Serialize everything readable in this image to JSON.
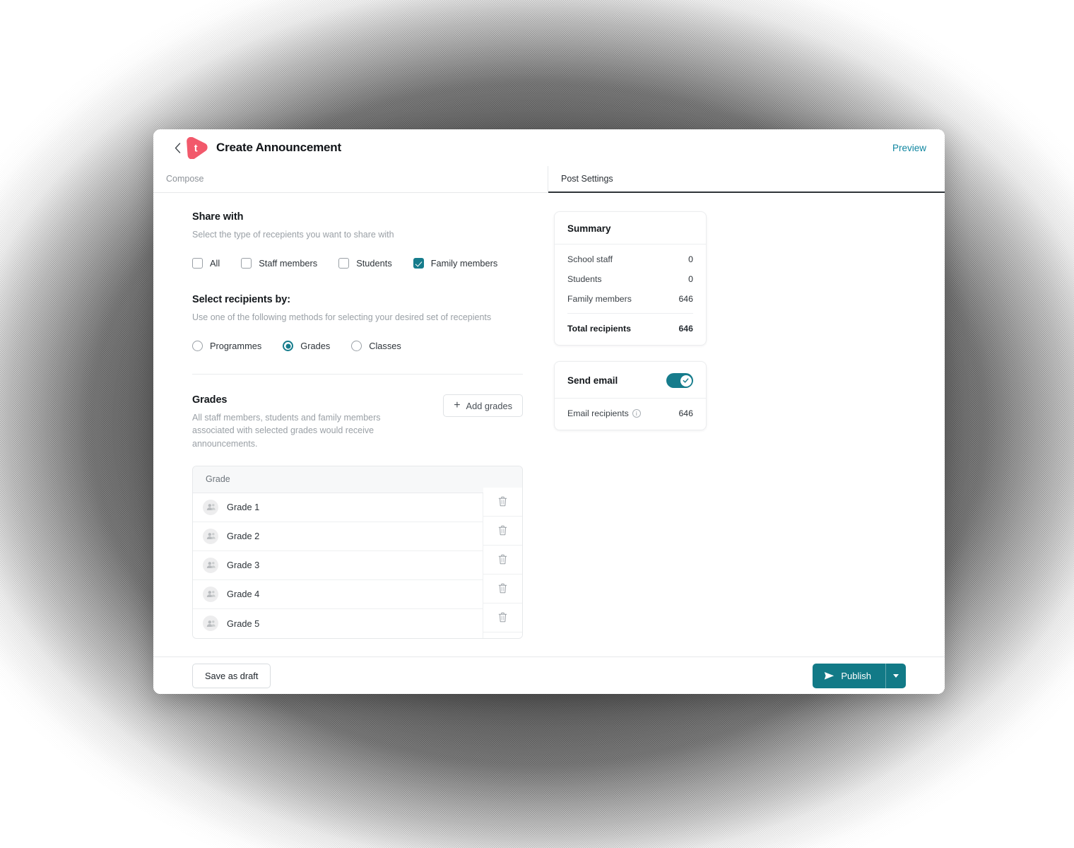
{
  "header": {
    "back_icon": "chevron-left-icon",
    "logo_letter": "t",
    "title": "Create Announcement",
    "preview_label": "Preview"
  },
  "tabs": [
    {
      "label": "Compose",
      "active": false
    },
    {
      "label": "Post Settings",
      "active": true
    }
  ],
  "share_with": {
    "title": "Share with",
    "subtitle": "Select the type of recepients you want to share with",
    "options": [
      {
        "label": "All",
        "checked": false
      },
      {
        "label": "Staff members",
        "checked": false
      },
      {
        "label": "Students",
        "checked": false
      },
      {
        "label": "Family members",
        "checked": true
      }
    ]
  },
  "select_by": {
    "title": "Select recipients by:",
    "subtitle": "Use one of the following methods for selecting your desired set of recepients",
    "options": [
      {
        "label": "Programmes",
        "selected": false
      },
      {
        "label": "Grades",
        "selected": true
      },
      {
        "label": "Classes",
        "selected": false
      }
    ]
  },
  "grades": {
    "title": "Grades",
    "subtitle": "All staff members, students and family members associated with selected grades would receive announcements.",
    "add_label": "Add grades",
    "add_icon": "plus-icon",
    "column_header": "Grade",
    "delete_icon": "trash-icon",
    "row_icon": "group-avatar-icon",
    "rows": [
      {
        "name": "Grade 1"
      },
      {
        "name": "Grade 2"
      },
      {
        "name": "Grade 3"
      },
      {
        "name": "Grade 4"
      },
      {
        "name": "Grade 5"
      }
    ]
  },
  "summary": {
    "title": "Summary",
    "rows": [
      {
        "label": "School staff",
        "value": "0"
      },
      {
        "label": "Students",
        "value": "0"
      },
      {
        "label": "Family members",
        "value": "646"
      }
    ],
    "total": {
      "label": "Total recipients",
      "value": "646"
    }
  },
  "send_email": {
    "title": "Send email",
    "toggle_on": true,
    "toggle_icon": "check-icon",
    "recipients_label": "Email recipients",
    "info_icon": "info-icon",
    "recipients_value": "646"
  },
  "footer": {
    "save_draft_label": "Save as draft",
    "publish_label": "Publish",
    "publish_icon": "send-icon",
    "publish_caret_icon": "chevron-down-icon"
  },
  "colors": {
    "accent_teal": "#167c8c",
    "publish_teal": "#127a87",
    "preview_link": "#0f86a0",
    "brand_pink": "#f2596b"
  }
}
